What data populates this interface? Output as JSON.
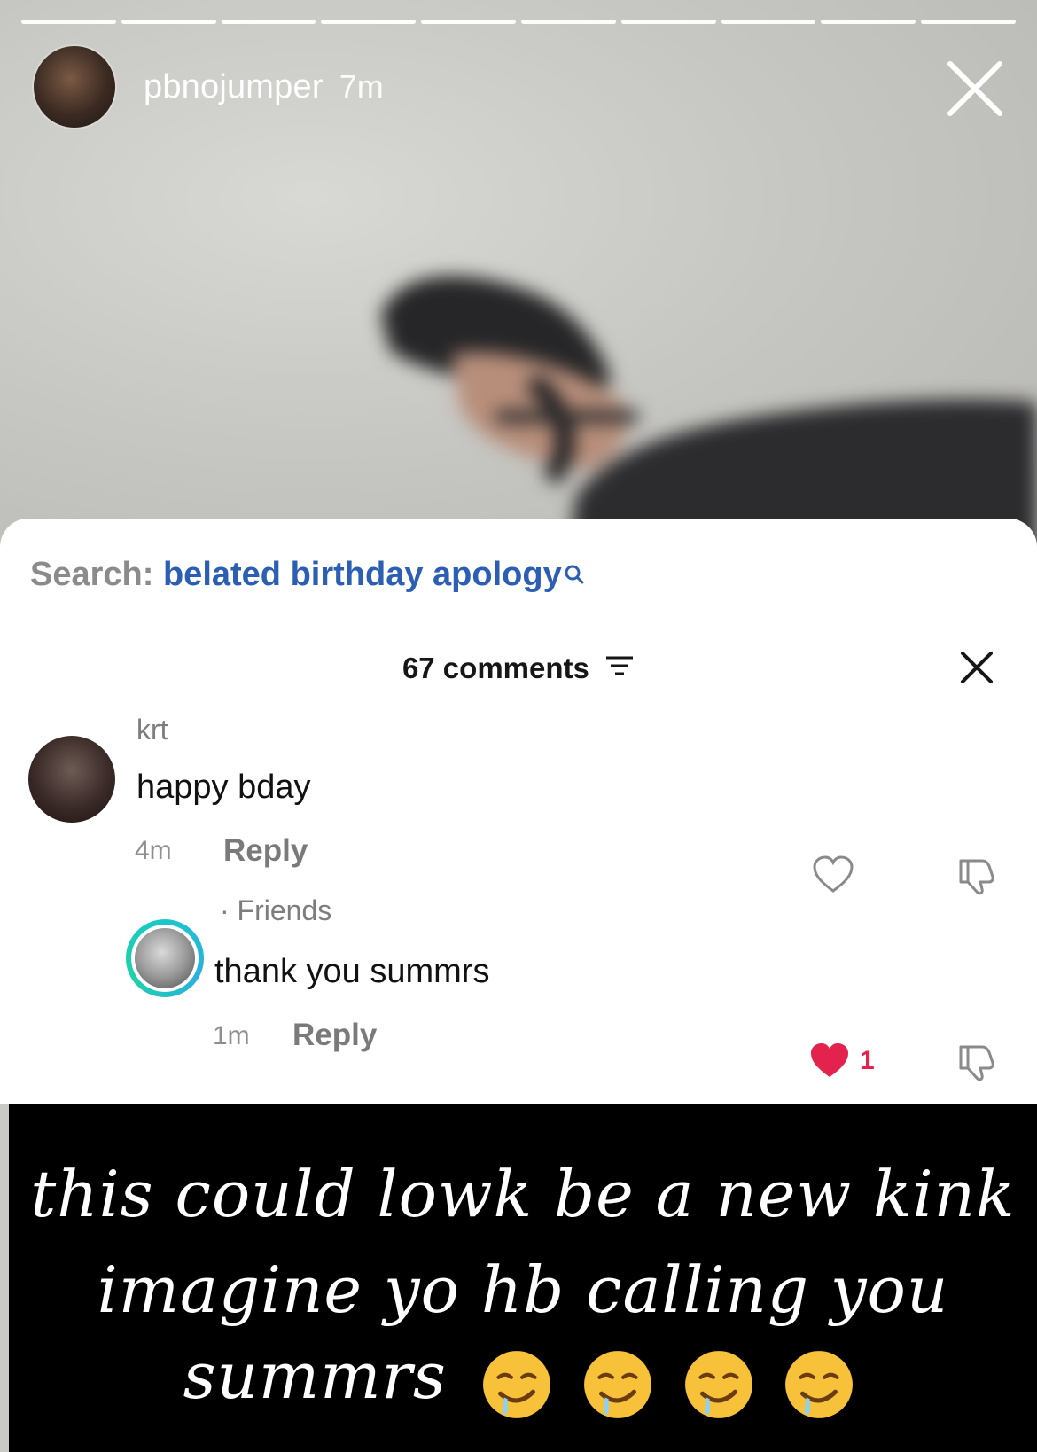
{
  "story": {
    "username": "pbnojumper",
    "time": "7m",
    "progress_segments": 10
  },
  "comments_panel": {
    "search_prefix": "Search:",
    "search_query": "belated birthday apology",
    "comments_count_label": "67 comments",
    "comments": [
      {
        "username": "krt",
        "text": "happy bday",
        "time": "4m",
        "reply_label": "Reply",
        "liked": false
      }
    ],
    "reply": {
      "username_suffix": "· Friends",
      "text": "thank you summrs",
      "time": "1m",
      "reply_label": "Reply",
      "liked": true,
      "like_count": "1"
    }
  },
  "caption": {
    "line1": "this could lowk be a new kink",
    "line2": "imagine yo hb calling you",
    "line3": "summrs",
    "emoji_name": "drooling-face",
    "emoji_count": 4
  },
  "colors": {
    "search_query": "#2c5fb4",
    "like_active": "#e3224d",
    "caption_bg": "#000000",
    "story_ring": "#19c7c9"
  }
}
